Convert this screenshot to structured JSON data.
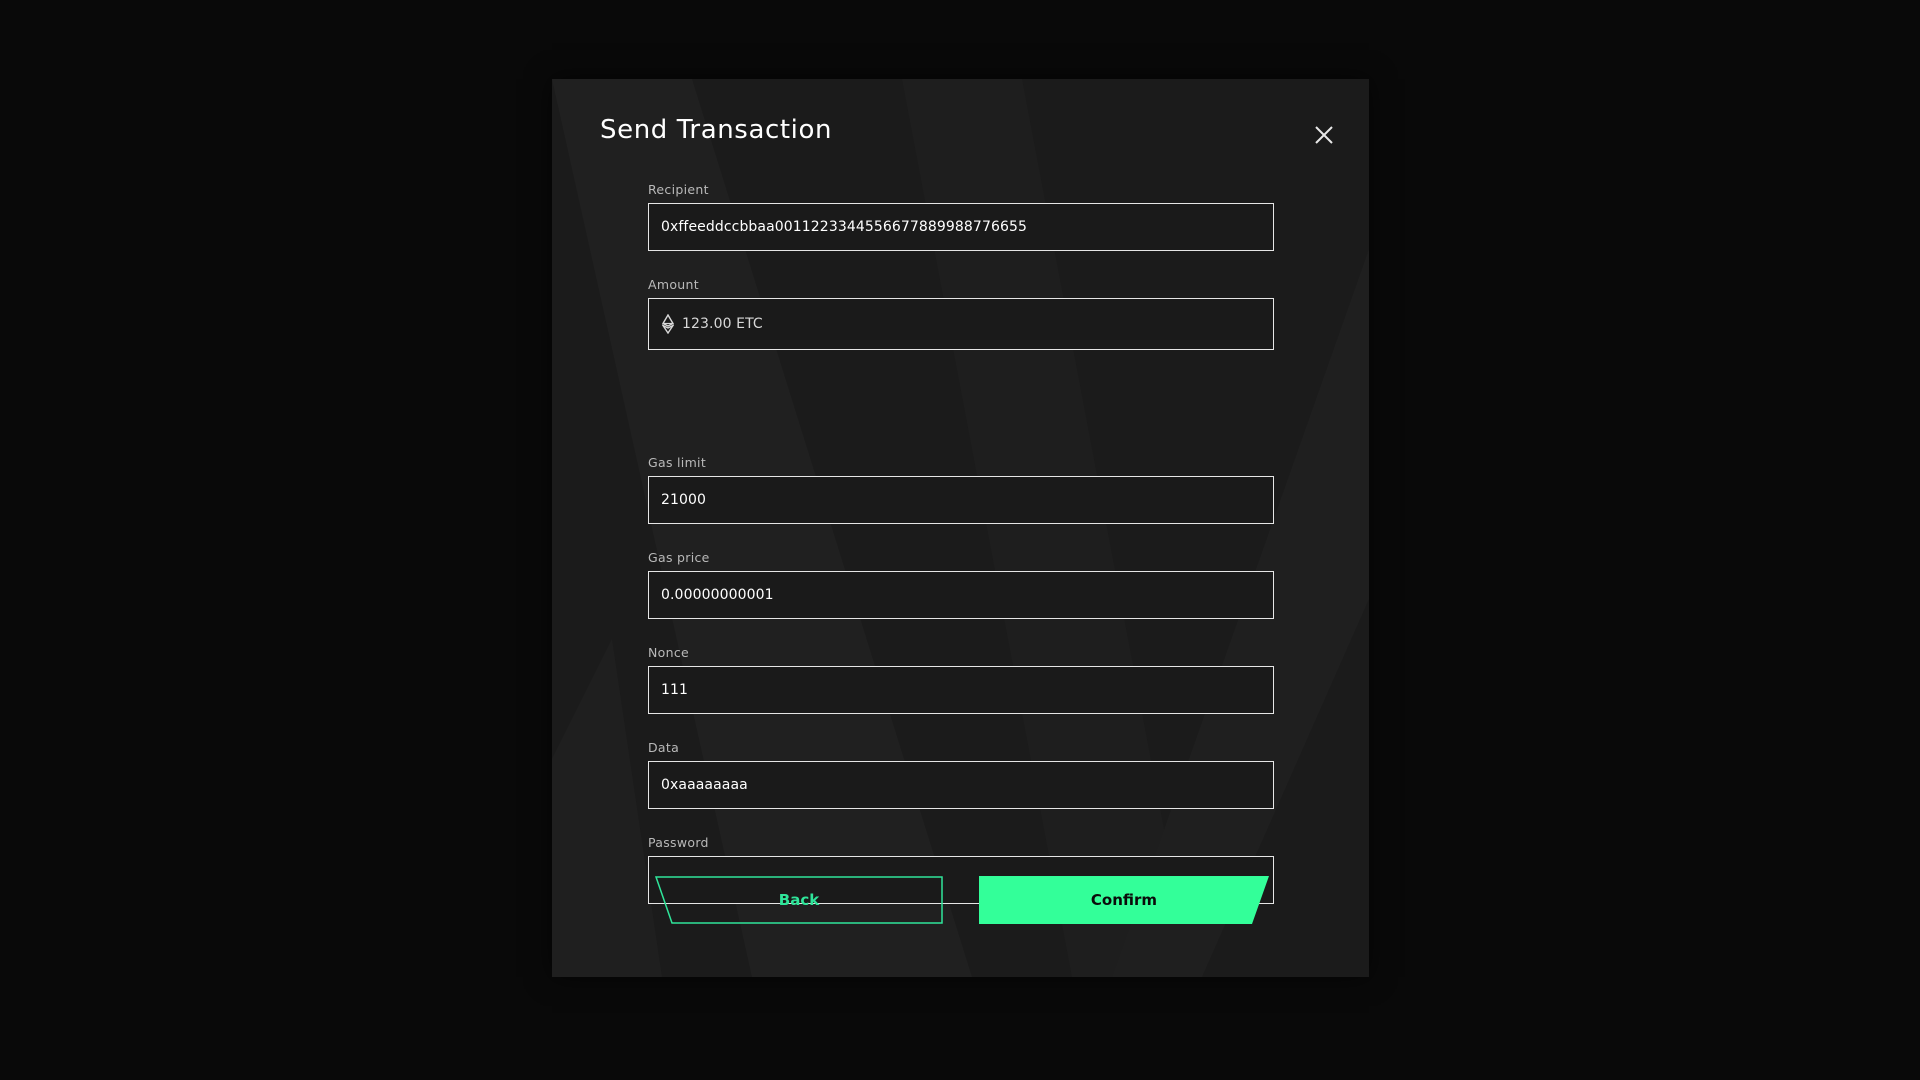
{
  "dialog": {
    "title": "Send Transaction"
  },
  "fields": {
    "recipient": {
      "label": "Recipient",
      "value": "0xffeeddccbbaa0011223344556677889988776655"
    },
    "amount": {
      "label": "Amount",
      "value": "123.00 ETC",
      "icon": "ethereum-classic-icon"
    },
    "gas_limit": {
      "label": "Gas limit",
      "value": "21000"
    },
    "gas_price": {
      "label": "Gas price",
      "value": "0.00000000001"
    },
    "nonce": {
      "label": "Nonce",
      "value": "111"
    },
    "data": {
      "label": "Data",
      "value": "0xaaaaaaaa"
    },
    "password": {
      "label": "Password",
      "value": ""
    }
  },
  "actions": {
    "back_label": "Back",
    "confirm_label": "Confirm"
  },
  "colors": {
    "accent": "#33ff99",
    "background": "#090909",
    "dialog": "#1b1b1b"
  }
}
